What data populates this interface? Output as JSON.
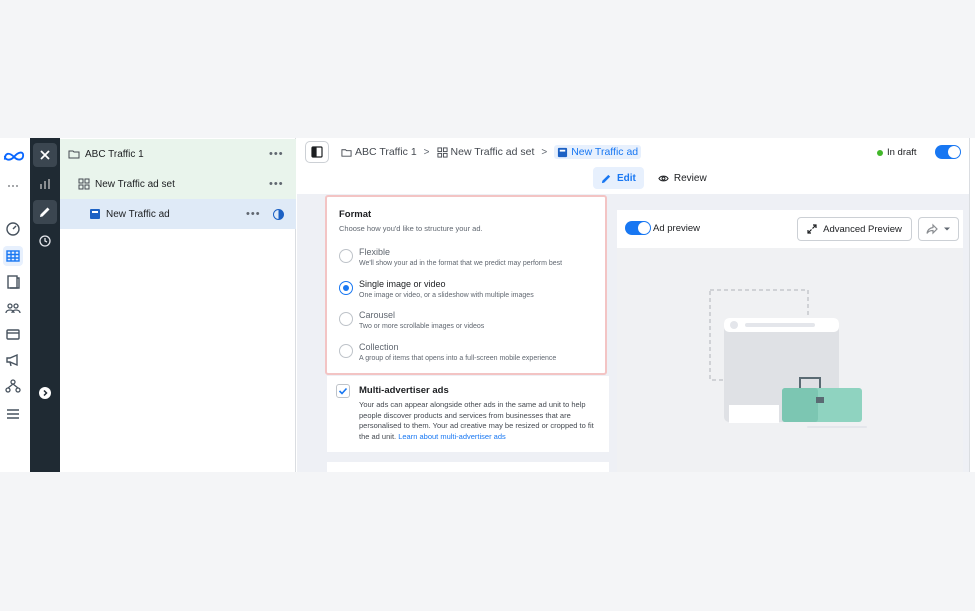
{
  "icons": {
    "rail": [
      "meta-logo",
      "app-switcher-icon",
      "chart-icon",
      "dashboard-icon",
      "table-icon",
      "pages-icon",
      "audience-icon",
      "billing-icon",
      "megaphone-icon",
      "network-icon",
      "menu-icon"
    ],
    "strip": [
      "close-icon",
      "edit-icon",
      "history-icon",
      "expand-icon"
    ]
  },
  "tree": {
    "campaign": "ABC Traffic 1",
    "adset": "New Traffic ad set",
    "ad": "New Traffic ad",
    "more": "•••"
  },
  "breadcrumb": {
    "campaign": "ABC Traffic 1",
    "adset": "New Traffic ad set",
    "ad": "New Traffic ad",
    "separator": ">"
  },
  "status": {
    "label": "In draft",
    "color": "#42b72a"
  },
  "tabs": {
    "edit": "Edit",
    "review": "Review"
  },
  "format": {
    "title": "Format",
    "subtitle": "Choose how you'd like to structure your ad.",
    "options": [
      {
        "label": "Flexible",
        "desc": "We'll show your ad in the format that we predict may perform best",
        "selected": false
      },
      {
        "label": "Single image or video",
        "desc": "One image or video, or a slideshow with multiple images",
        "selected": true
      },
      {
        "label": "Carousel",
        "desc": "Two or more scrollable images or videos",
        "selected": false
      },
      {
        "label": "Collection",
        "desc": "A group of items that opens into a full-screen mobile experience",
        "selected": false
      }
    ]
  },
  "multi_advertiser": {
    "title": "Multi-advertiser ads",
    "checked": true,
    "body": "Your ads can appear alongside other ads in the same ad unit to help people discover products and services from businesses that are personalised to them. Your ad creative may be resized or cropped to fit the ad unit.",
    "link": "Learn about multi-advertiser ads"
  },
  "preview": {
    "toggle_label": "Ad preview",
    "advanced_button": "Advanced Preview"
  },
  "colors": {
    "accent": "#1877f2",
    "strip": "#1f2a33",
    "highlight_border": "#f3c4c4"
  }
}
